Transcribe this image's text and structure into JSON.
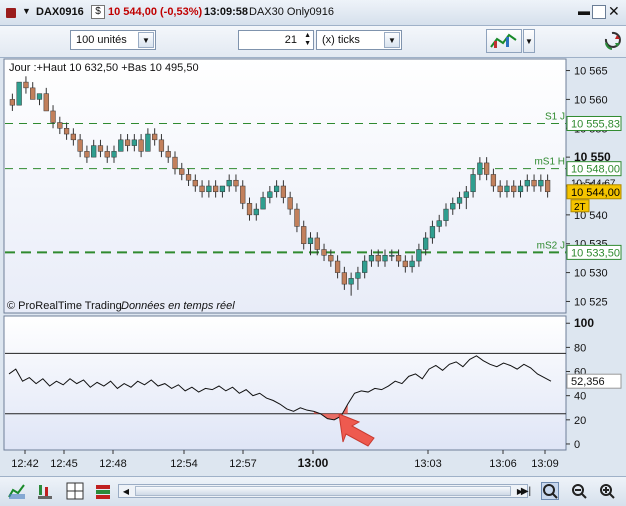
{
  "window": {
    "symbol": "DAX0916",
    "price_change": "10 544,00 (-0,53%)",
    "time": "13:09:58",
    "instrument": "DAX30 Only0916"
  },
  "toolbar": {
    "units_value": "100 unités",
    "period_value": "21",
    "period_unit": "(x) ticks"
  },
  "price_panel": {
    "header": "Jour :+Haut 10 632,50 +Bas 10 495,50",
    "footer_brand": "© ProRealTime Trading",
    "footer_data": "Données en temps réel",
    "ticks": [
      "10 565",
      "10 560",
      "10 555",
      "10 550",
      "10 545",
      "10 540",
      "10 535",
      "10 530",
      "10 525"
    ],
    "tick_values": [
      10565,
      10560,
      10555,
      10550,
      10545,
      10540,
      10535,
      10530,
      10525
    ],
    "levels": [
      {
        "label": "S1 J",
        "value_text": "10 555,83",
        "value": 10555.83
      },
      {
        "label": "mS1 H",
        "value_text": "10 548,00",
        "value": 10548.0
      },
      {
        "label": "mS2 J",
        "value_text": "10 533,50",
        "value": 10533.5
      }
    ],
    "partial_label": "10 544,67",
    "current_price": "10 544,00",
    "current_value": 10544.0,
    "tag": "2T"
  },
  "indicator_panel": {
    "ticks": [
      "100",
      "80",
      "60",
      "40",
      "20",
      "0"
    ],
    "tick_values": [
      100,
      80,
      60,
      40,
      20,
      0
    ],
    "current_value": "52,356",
    "level_high": 75,
    "level_low": 25
  },
  "time_axis": [
    "12:42",
    "12:45",
    "12:48",
    "12:54",
    "12:57",
    "13:00",
    "13:03",
    "13:06",
    "13:09"
  ],
  "chart_data": {
    "type": "candlestick",
    "candles": [
      [
        10560,
        10561,
        10558,
        10559
      ],
      [
        10559,
        10563,
        10559,
        10563
      ],
      [
        10563,
        10564,
        10561,
        10562
      ],
      [
        10562,
        10563,
        10560,
        10560
      ],
      [
        10560,
        10561,
        10559,
        10561
      ],
      [
        10561,
        10562,
        10558,
        10558
      ],
      [
        10558,
        10559,
        10555,
        10556
      ],
      [
        10556,
        10557,
        10554,
        10555
      ],
      [
        10555,
        10556,
        10553,
        10554
      ],
      [
        10554,
        10555,
        10552,
        10553
      ],
      [
        10553,
        10554,
        10550,
        10551
      ],
      [
        10551,
        10552,
        10549,
        10550
      ],
      [
        10550,
        10553,
        10550,
        10552
      ],
      [
        10552,
        10553,
        10550,
        10551
      ],
      [
        10551,
        10552,
        10549,
        10550
      ],
      [
        10550,
        10552,
        10549,
        10551
      ],
      [
        10551,
        10554,
        10551,
        10553
      ],
      [
        10553,
        10554,
        10551,
        10552
      ],
      [
        10552,
        10554,
        10551,
        10553
      ],
      [
        10553,
        10554,
        10550,
        10551
      ],
      [
        10551,
        10555,
        10551,
        10554
      ],
      [
        10554,
        10555,
        10552,
        10553
      ],
      [
        10553,
        10554,
        10550,
        10551
      ],
      [
        10551,
        10552,
        10549,
        10550
      ],
      [
        10550,
        10551,
        10547,
        10548
      ],
      [
        10548,
        10549,
        10546,
        10547
      ],
      [
        10547,
        10548,
        10545,
        10546
      ],
      [
        10546,
        10547,
        10544,
        10545
      ],
      [
        10545,
        10546,
        10543,
        10544
      ],
      [
        10544,
        10546,
        10543,
        10545
      ],
      [
        10545,
        10546,
        10543,
        10544
      ],
      [
        10544,
        10545,
        10543,
        10545
      ],
      [
        10545,
        10547,
        10544,
        10546
      ],
      [
        10546,
        10547,
        10544,
        10545
      ],
      [
        10545,
        10546,
        10541,
        10542
      ],
      [
        10542,
        10543,
        10539,
        10540
      ],
      [
        10540,
        10542,
        10539,
        10541
      ],
      [
        10541,
        10544,
        10541,
        10543
      ],
      [
        10543,
        10545,
        10542,
        10544
      ],
      [
        10544,
        10546,
        10543,
        10545
      ],
      [
        10545,
        10546,
        10542,
        10543
      ],
      [
        10543,
        10544,
        10540,
        10541
      ],
      [
        10541,
        10542,
        10537,
        10538
      ],
      [
        10538,
        10539,
        10534,
        10535
      ],
      [
        10535,
        10537,
        10533,
        10536
      ],
      [
        10536,
        10537,
        10533,
        10534
      ],
      [
        10534,
        10535,
        10532,
        10533
      ],
      [
        10533,
        10534,
        10531,
        10532
      ],
      [
        10532,
        10533,
        10529,
        10530
      ],
      [
        10530,
        10531,
        10527,
        10528
      ],
      [
        10528,
        10530,
        10526,
        10529
      ],
      [
        10529,
        10531,
        10527,
        10530
      ],
      [
        10530,
        10533,
        10529,
        10532
      ],
      [
        10532,
        10534,
        10531,
        10533
      ],
      [
        10533,
        10534,
        10531,
        10532
      ],
      [
        10532,
        10534,
        10531,
        10533
      ],
      [
        10533,
        10534,
        10532,
        10533
      ],
      [
        10533,
        10534,
        10531,
        10532
      ],
      [
        10532,
        10533,
        10530,
        10531
      ],
      [
        10531,
        10533,
        10530,
        10532
      ],
      [
        10532,
        10535,
        10531,
        10534
      ],
      [
        10534,
        10537,
        10533,
        10536
      ],
      [
        10536,
        10539,
        10535,
        10538
      ],
      [
        10538,
        10540,
        10537,
        10539
      ],
      [
        10539,
        10542,
        10538,
        10541
      ],
      [
        10541,
        10543,
        10540,
        10542
      ],
      [
        10542,
        10544,
        10541,
        10543
      ],
      [
        10543,
        10545,
        10541,
        10544
      ],
      [
        10544,
        10548,
        10543,
        10547
      ],
      [
        10547,
        10550,
        10546,
        10549
      ],
      [
        10549,
        10550,
        10546,
        10547
      ],
      [
        10547,
        10548,
        10544,
        10545
      ],
      [
        10545,
        10546,
        10543,
        10544
      ],
      [
        10544,
        10546,
        10543,
        10545
      ],
      [
        10545,
        10546,
        10543,
        10544
      ],
      [
        10544,
        10546,
        10543,
        10545
      ],
      [
        10545,
        10547,
        10544,
        10546
      ],
      [
        10546,
        10547,
        10544,
        10545
      ],
      [
        10545,
        10547,
        10544,
        10546
      ],
      [
        10546,
        10547,
        10543,
        10544
      ]
    ],
    "oscillator": [
      58,
      62,
      52,
      55,
      50,
      54,
      48,
      52,
      49,
      54,
      50,
      53,
      47,
      51,
      48,
      52,
      46,
      50,
      47,
      52,
      49,
      53,
      48,
      50,
      46,
      49,
      44,
      47,
      43,
      46,
      45,
      48,
      44,
      47,
      42,
      45,
      40,
      42,
      38,
      36,
      33,
      29,
      27,
      30,
      28,
      27,
      25,
      21,
      20,
      23,
      33,
      42,
      44,
      43,
      46,
      45,
      48,
      52,
      50,
      56,
      58,
      54,
      62,
      65,
      61,
      66,
      68,
      64,
      70,
      73,
      69,
      66,
      64,
      67,
      65,
      62,
      66,
      63,
      58,
      55,
      52
    ]
  }
}
